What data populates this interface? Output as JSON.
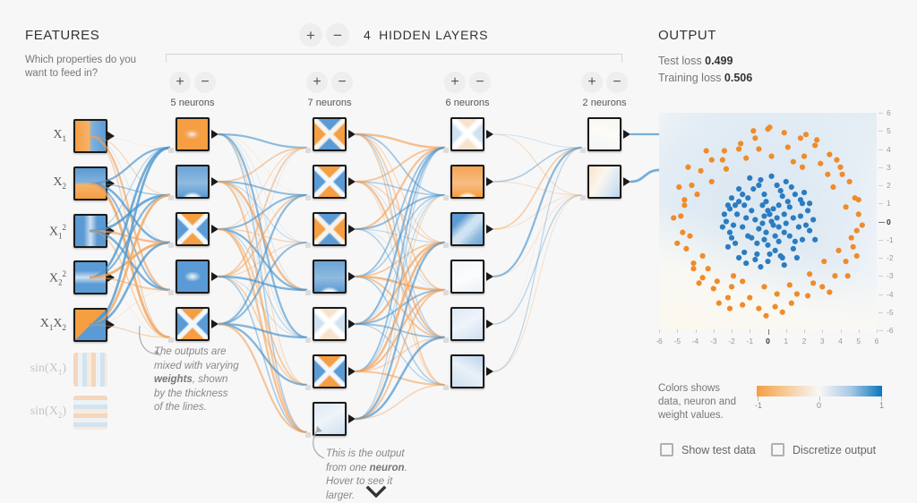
{
  "features": {
    "title": "FEATURES",
    "subtitle": "Which properties do you want to feed in?",
    "items": [
      {
        "label_html": "X<sub>1</sub>",
        "texture": "tx-half-ob",
        "active": true
      },
      {
        "label_html": "X<sub>2</sub>",
        "texture": "tx-half-bo",
        "active": true
      },
      {
        "label_html": "X<sub>1</sub><sup>2</sup>",
        "texture": "tx-vband",
        "active": true
      },
      {
        "label_html": "X<sub>2</sub><sup>2</sup>",
        "texture": "tx-hband",
        "active": true
      },
      {
        "label_html": "X<sub>1</sub>X<sub>2</sub>",
        "texture": "tx-quad",
        "active": true
      },
      {
        "label_html": "sin(X<sub>1</sub>)",
        "texture": "tx-sin-v",
        "active": false
      },
      {
        "label_html": "sin(X<sub>2</sub>)",
        "texture": "tx-sin-h",
        "active": false
      }
    ]
  },
  "hidden": {
    "add_label": "+",
    "remove_label": "−",
    "count": "4",
    "title": "HIDDEN LAYERS",
    "layers": [
      {
        "neurons_label": "5 neurons",
        "count": 5,
        "textures": [
          "tx-blob-o",
          "tx-vee-b",
          "tx-x-bo",
          "tx-blob-b",
          "tx-x-bo"
        ]
      },
      {
        "neurons_label": "7 neurons",
        "count": 7,
        "textures": [
          "tx-x-ob",
          "tx-x-bo",
          "tx-x-ob",
          "tx-vee-b",
          "tx-faintx",
          "tx-x-bo",
          "tx-pale-b"
        ]
      },
      {
        "neurons_label": "6 neurons",
        "count": 6,
        "textures": [
          "tx-faintx",
          "tx-vee-o",
          "tx-diag-b",
          "tx-pale-w",
          "tx-pale-b",
          "tx-pale-b2"
        ]
      },
      {
        "neurons_label": "2 neurons",
        "count": 2,
        "textures": [
          "tx-pale-wo",
          "tx-mix-ob"
        ]
      }
    ]
  },
  "annotations": {
    "weights_line1": "The outputs are",
    "weights_line2": "mixed with varying",
    "weights_bold": "weights",
    "weights_line3b": ", shown",
    "weights_line4": "by the thickness",
    "weights_line5": "of the lines.",
    "neuron_line1": "This is the output",
    "neuron_line2a": "from one ",
    "neuron_bold": "neuron",
    "neuron_line2b": ".",
    "neuron_line3": "Hover to see it",
    "neuron_line4": "larger."
  },
  "output": {
    "title": "OUTPUT",
    "test_loss_label": "Test loss",
    "test_loss_value": "0.499",
    "training_loss_label": "Training loss",
    "training_loss_value": "0.506"
  },
  "legend": {
    "line1": "Colors shows",
    "line2": "data, neuron and",
    "line3": "weight values.",
    "min": "-1",
    "mid": "0",
    "max": "1",
    "color_negative": "#f59e42",
    "color_neutral": "#f7f7f7",
    "color_positive": "#0877bd"
  },
  "checkboxes": [
    {
      "label": "Show test data",
      "checked": false
    },
    {
      "label": "Discretize output",
      "checked": false
    }
  ],
  "chart_data": {
    "type": "scatter",
    "title": "OUTPUT",
    "xlabel": "",
    "ylabel": "",
    "xlim": [
      -6,
      6
    ],
    "ylim": [
      -6,
      6
    ],
    "grid": false,
    "legend_position": "below",
    "xticks": [
      -6,
      -5,
      -4,
      -3,
      -2,
      -1,
      0,
      1,
      2,
      3,
      4,
      5,
      6
    ],
    "yticks": [
      6,
      5,
      4,
      3,
      2,
      1,
      0,
      -1,
      -2,
      -3,
      -4,
      -5,
      -6
    ],
    "series": [
      {
        "name": "class-positive-blue",
        "color": "#2b7cc0",
        "description": "inner dense cluster centered at origin, radius ~0 to 2.6",
        "points": [
          [
            -0.4,
            2.3
          ],
          [
            0.5,
            2.0
          ],
          [
            1.3,
            1.9
          ],
          [
            -1.1,
            1.3
          ],
          [
            -0.2,
            1.5
          ],
          [
            0.8,
            1.4
          ],
          [
            1.8,
            1.2
          ],
          [
            2.2,
            0.6
          ],
          [
            2.5,
            0.1
          ],
          [
            2.3,
            -0.5
          ],
          [
            1.9,
            -1.0
          ],
          [
            1.4,
            -1.5
          ],
          [
            0.7,
            -1.9
          ],
          [
            0.0,
            -2.2
          ],
          [
            -0.7,
            -2.1
          ],
          [
            -1.3,
            -1.7
          ],
          [
            -1.8,
            -1.2
          ],
          [
            -2.1,
            -0.6
          ],
          [
            -2.3,
            0.0
          ],
          [
            -2.1,
            0.7
          ],
          [
            -1.6,
            1.1
          ],
          [
            -0.9,
            0.6
          ],
          [
            -0.3,
            0.9
          ],
          [
            0.3,
            0.7
          ],
          [
            0.9,
            0.4
          ],
          [
            1.4,
            0.2
          ],
          [
            1.7,
            -0.3
          ],
          [
            1.2,
            -0.8
          ],
          [
            0.6,
            -1.1
          ],
          [
            0.0,
            -1.3
          ],
          [
            -0.6,
            -1.2
          ],
          [
            -1.1,
            -0.8
          ],
          [
            -1.4,
            -0.3
          ],
          [
            -1.2,
            0.2
          ],
          [
            -0.7,
            0.1
          ],
          [
            -0.2,
            0.3
          ],
          [
            0.2,
            0.0
          ],
          [
            0.6,
            -0.3
          ],
          [
            0.9,
            -0.6
          ],
          [
            0.4,
            -0.8
          ],
          [
            -0.1,
            -0.6
          ],
          [
            -0.5,
            -0.4
          ],
          [
            -0.3,
            -0.1
          ],
          [
            0.1,
            0.4
          ],
          [
            0.5,
            0.2
          ],
          [
            -0.8,
            1.8
          ],
          [
            0.2,
            2.5
          ],
          [
            1.0,
            2.2
          ],
          [
            -1.6,
            1.8
          ],
          [
            -2.0,
            1.3
          ],
          [
            2.0,
            1.6
          ],
          [
            2.6,
            -1.0
          ],
          [
            1.6,
            -2.0
          ],
          [
            0.9,
            -2.4
          ],
          [
            -0.4,
            -2.5
          ],
          [
            -1.6,
            -2.0
          ],
          [
            -2.2,
            -1.4
          ],
          [
            -2.5,
            -0.3
          ],
          [
            -2.2,
            0.9
          ],
          [
            -1.0,
            2.4
          ],
          [
            0.3,
            -0.2
          ],
          [
            1.1,
            1.1
          ],
          [
            -1.3,
            0.9
          ],
          [
            1.5,
            -1.1
          ],
          [
            -1.9,
            -0.2
          ],
          [
            0.7,
            1.7
          ],
          [
            -0.6,
            -1.8
          ],
          [
            2.1,
            -0.2
          ],
          [
            -0.1,
            1.1
          ],
          [
            1.2,
            0.8
          ],
          [
            -1.7,
            0.4
          ],
          [
            0.4,
            -1.6
          ],
          [
            1.8,
            0.3
          ],
          [
            -0.9,
            -0.9
          ],
          [
            0.0,
            0.6
          ],
          [
            -1.4,
            1.5
          ],
          [
            2.3,
            1.0
          ],
          [
            -2.4,
            0.4
          ],
          [
            1.0,
            -0.1
          ],
          [
            -0.2,
            -1.0
          ],
          [
            0.8,
            -2.0
          ],
          [
            -1.2,
            -2.3
          ],
          [
            1.9,
            1.0
          ],
          [
            -2.0,
            -0.9
          ],
          [
            0.6,
            0.9
          ],
          [
            -0.5,
            2.0
          ],
          [
            1.5,
            1.5
          ],
          [
            -1.8,
            0.9
          ],
          [
            0.1,
            -1.8
          ]
        ]
      },
      {
        "name": "class-negative-orange",
        "color": "#f08b29",
        "description": "outer annulus ring, radius ~3.4 to 5.3",
        "points": [
          [
            0.0,
            5.1
          ],
          [
            0.9,
            4.9
          ],
          [
            1.8,
            4.6
          ],
          [
            2.6,
            4.2
          ],
          [
            3.4,
            3.7
          ],
          [
            4.0,
            3.0
          ],
          [
            4.5,
            2.2
          ],
          [
            4.8,
            1.3
          ],
          [
            5.0,
            0.4
          ],
          [
            4.9,
            -0.5
          ],
          [
            4.7,
            -1.4
          ],
          [
            4.3,
            -2.2
          ],
          [
            3.7,
            -3.0
          ],
          [
            3.0,
            -3.6
          ],
          [
            2.2,
            -4.1
          ],
          [
            1.3,
            -4.5
          ],
          [
            0.4,
            -4.7
          ],
          [
            -0.5,
            -4.8
          ],
          [
            -1.4,
            -4.6
          ],
          [
            -2.2,
            -4.2
          ],
          [
            -3.0,
            -3.7
          ],
          [
            -3.6,
            -3.1
          ],
          [
            -4.1,
            -2.3
          ],
          [
            -4.5,
            -1.5
          ],
          [
            -4.7,
            -0.6
          ],
          [
            -4.8,
            0.3
          ],
          [
            -4.6,
            1.2
          ],
          [
            -4.2,
            2.0
          ],
          [
            -3.7,
            2.8
          ],
          [
            -3.1,
            3.4
          ],
          [
            -2.4,
            3.9
          ],
          [
            -1.5,
            4.3
          ],
          [
            -0.7,
            4.6
          ],
          [
            -3.9,
            1.5
          ],
          [
            3.9,
            -1.6
          ],
          [
            -2.8,
            -3.3
          ],
          [
            2.9,
            3.2
          ],
          [
            -1.0,
            -4.2
          ],
          [
            1.1,
            4.1
          ],
          [
            4.3,
            0.8
          ],
          [
            -4.3,
            -0.8
          ],
          [
            3.3,
            2.6
          ],
          [
            -3.3,
            -2.6
          ],
          [
            0.5,
            -4.0
          ],
          [
            -0.5,
            4.0
          ],
          [
            2.0,
            3.6
          ],
          [
            -2.0,
            -3.6
          ],
          [
            4.6,
            -0.9
          ],
          [
            -4.6,
            0.9
          ],
          [
            1.6,
            -4.0
          ],
          [
            -1.6,
            4.0
          ],
          [
            3.6,
            1.9
          ],
          [
            -3.6,
            -1.9
          ],
          [
            -2.5,
            3.4
          ],
          [
            2.5,
            -3.4
          ],
          [
            0.2,
            3.6
          ],
          [
            -0.2,
            -3.6
          ],
          [
            4.1,
            2.6
          ],
          [
            -4.1,
            -2.6
          ],
          [
            5.2,
            -0.2
          ],
          [
            -5.2,
            0.2
          ],
          [
            2.7,
            4.5
          ],
          [
            -2.7,
            -4.5
          ],
          [
            -4.9,
            1.9
          ],
          [
            4.9,
            -1.9
          ],
          [
            1.2,
            -3.5
          ],
          [
            -1.2,
            3.5
          ],
          [
            3.1,
            -2.2
          ],
          [
            -3.1,
            2.2
          ],
          [
            0.8,
            -5.0
          ],
          [
            -0.8,
            5.0
          ],
          [
            -3.4,
            3.9
          ],
          [
            3.4,
            -3.9
          ],
          [
            4.4,
            -3.0
          ],
          [
            -4.4,
            3.0
          ],
          [
            2.3,
            -2.9
          ],
          [
            -2.3,
            2.9
          ],
          [
            1.4,
            3.3
          ],
          [
            -1.4,
            -3.3
          ],
          [
            -0.1,
            -5.2
          ],
          [
            0.1,
            5.2
          ],
          [
            3.8,
            3.4
          ],
          [
            -3.8,
            -3.4
          ],
          [
            -5.0,
            -1.2
          ],
          [
            5.0,
            1.2
          ],
          [
            2.1,
            4.8
          ],
          [
            -2.1,
            -4.8
          ],
          [
            -1.9,
            -3.0
          ],
          [
            1.9,
            3.0
          ]
        ]
      }
    ]
  }
}
